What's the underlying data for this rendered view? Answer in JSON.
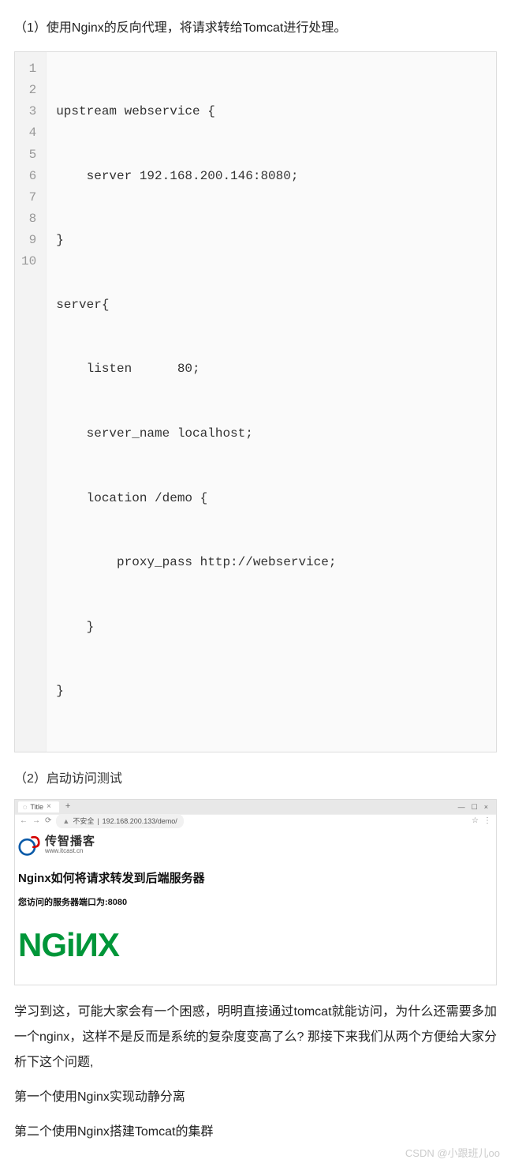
{
  "step1_label": "（1）使用Nginx的反向代理，将请求转给Tomcat进行处理。",
  "code": {
    "lines": [
      "upstream webservice {",
      "    server 192.168.200.146:8080;",
      "}",
      "server{",
      "    listen      80;",
      "    server_name localhost;",
      "    location /demo {",
      "        proxy_pass http://webservice;",
      "    }",
      "}"
    ],
    "numbers": [
      "1",
      "2",
      "3",
      "4",
      "5",
      "6",
      "7",
      "8",
      "9",
      "10"
    ]
  },
  "step2_label": "（2）启动访问测试",
  "browser": {
    "tab_title": "Title",
    "url_warning": "不安全",
    "url": "192.168.200.133/demo/",
    "brand_name": "传智播客",
    "brand_sub": "www.itcast.cn",
    "page_title": "Nginx如何将请求转发到后端服务器",
    "page_sub": "您访问的服务器端口为:8080",
    "nginx_logo_text": "NGiИX"
  },
  "para1": "学习到这，可能大家会有一个困惑，明明直接通过tomcat就能访问，为什么还需要多加一个nginx，这样不是反而是系统的复杂度变高了么? 那接下来我们从两个方便给大家分析下这个问题,",
  "para2": "第一个使用Nginx实现动静分离",
  "para3": "第二个使用Nginx搭建Tomcat的集群",
  "watermark": "CSDN @小跟班儿oo"
}
